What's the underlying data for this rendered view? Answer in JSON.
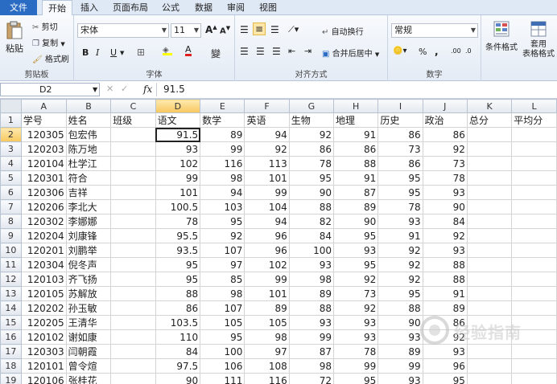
{
  "tabs": [
    "文件",
    "开始",
    "插入",
    "页面布局",
    "公式",
    "数据",
    "审阅",
    "视图"
  ],
  "clipboard": {
    "paste": "粘贴",
    "cut": "剪切",
    "copy": "复制",
    "format_painter": "格式刷",
    "label": "剪贴板"
  },
  "font": {
    "name": "宋体",
    "size": "11",
    "bold": "B",
    "italic": "I",
    "underline": "U",
    "grow": "A",
    "shrink": "A",
    "wen": "變",
    "label": "字体"
  },
  "alignment": {
    "wrap": "自动换行",
    "merge": "合并后居中",
    "label": "对齐方式"
  },
  "number": {
    "format": "常规",
    "percent": "%",
    "comma": ",",
    "label": "数字"
  },
  "styles": {
    "conditional": "条件格式",
    "table": "套用\n表格格式"
  },
  "formula_bar": {
    "cell": "D2",
    "fx": "fx",
    "value": "91.5"
  },
  "columns": [
    "A",
    "B",
    "C",
    "D",
    "E",
    "F",
    "G",
    "H",
    "I",
    "J",
    "K",
    "L"
  ],
  "header_row": [
    "学号",
    "姓名",
    "班级",
    "语文",
    "数学",
    "英语",
    "生物",
    "地理",
    "历史",
    "政治",
    "总分",
    "平均分"
  ],
  "rows": [
    [
      "120305",
      "包宏伟",
      "",
      "91.5",
      "89",
      "94",
      "92",
      "91",
      "86",
      "86",
      "",
      ""
    ],
    [
      "120203",
      "陈万地",
      "",
      "93",
      "99",
      "92",
      "86",
      "86",
      "73",
      "92",
      "",
      ""
    ],
    [
      "120104",
      "杜学江",
      "",
      "102",
      "116",
      "113",
      "78",
      "88",
      "86",
      "73",
      "",
      ""
    ],
    [
      "120301",
      "符合",
      "",
      "99",
      "98",
      "101",
      "95",
      "91",
      "95",
      "78",
      "",
      ""
    ],
    [
      "120306",
      "吉祥",
      "",
      "101",
      "94",
      "99",
      "90",
      "87",
      "95",
      "93",
      "",
      ""
    ],
    [
      "120206",
      "李北大",
      "",
      "100.5",
      "103",
      "104",
      "88",
      "89",
      "78",
      "90",
      "",
      ""
    ],
    [
      "120302",
      "李娜娜",
      "",
      "78",
      "95",
      "94",
      "82",
      "90",
      "93",
      "84",
      "",
      ""
    ],
    [
      "120204",
      "刘康锋",
      "",
      "95.5",
      "92",
      "96",
      "84",
      "95",
      "91",
      "92",
      "",
      ""
    ],
    [
      "120201",
      "刘鹏举",
      "",
      "93.5",
      "107",
      "96",
      "100",
      "93",
      "92",
      "93",
      "",
      ""
    ],
    [
      "120304",
      "倪冬声",
      "",
      "95",
      "97",
      "102",
      "93",
      "95",
      "92",
      "88",
      "",
      ""
    ],
    [
      "120103",
      "齐飞扬",
      "",
      "95",
      "85",
      "99",
      "98",
      "92",
      "92",
      "88",
      "",
      ""
    ],
    [
      "120105",
      "苏解放",
      "",
      "88",
      "98",
      "101",
      "89",
      "73",
      "95",
      "91",
      "",
      ""
    ],
    [
      "120202",
      "孙玉敏",
      "",
      "86",
      "107",
      "89",
      "88",
      "92",
      "88",
      "89",
      "",
      ""
    ],
    [
      "120205",
      "王清华",
      "",
      "103.5",
      "105",
      "105",
      "93",
      "93",
      "90",
      "86",
      "",
      ""
    ],
    [
      "120102",
      "谢如康",
      "",
      "110",
      "95",
      "98",
      "99",
      "93",
      "93",
      "92",
      "",
      ""
    ],
    [
      "120303",
      "闫朝霞",
      "",
      "84",
      "100",
      "97",
      "87",
      "78",
      "89",
      "93",
      "",
      ""
    ],
    [
      "120101",
      "曾令煊",
      "",
      "97.5",
      "106",
      "108",
      "98",
      "99",
      "99",
      "96",
      "",
      ""
    ],
    [
      "120106",
      "张桂花",
      "",
      "90",
      "111",
      "116",
      "72",
      "95",
      "93",
      "95",
      "",
      ""
    ]
  ],
  "watermark": "经验指南"
}
